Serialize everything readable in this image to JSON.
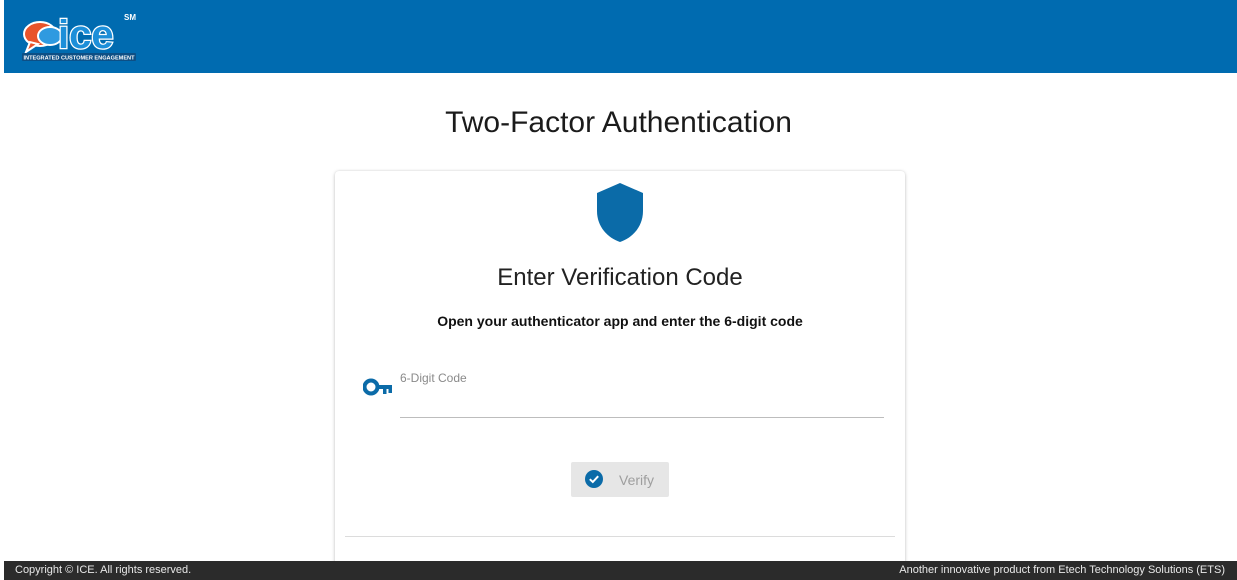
{
  "header": {
    "logo_text": "ice",
    "logo_tagline": "INTEGRATED CUSTOMER ENGAGEMENT",
    "logo_mark": "SM",
    "brand_color": "#006bb0"
  },
  "page": {
    "title": "Two-Factor Authentication"
  },
  "card": {
    "icon": "shield-icon",
    "title": "Enter Verification Code",
    "subtitle": "Open your authenticator app and enter the 6-digit code",
    "field": {
      "icon": "key-icon",
      "label": "6-Digit Code",
      "value": ""
    },
    "verify_button": {
      "icon": "check-circle-icon",
      "label": "Verify"
    }
  },
  "footer": {
    "left_text": "Copyright © ICE. All rights reserved.",
    "right_text": "Another innovative product from Etech Technology Solutions (ETS)"
  }
}
